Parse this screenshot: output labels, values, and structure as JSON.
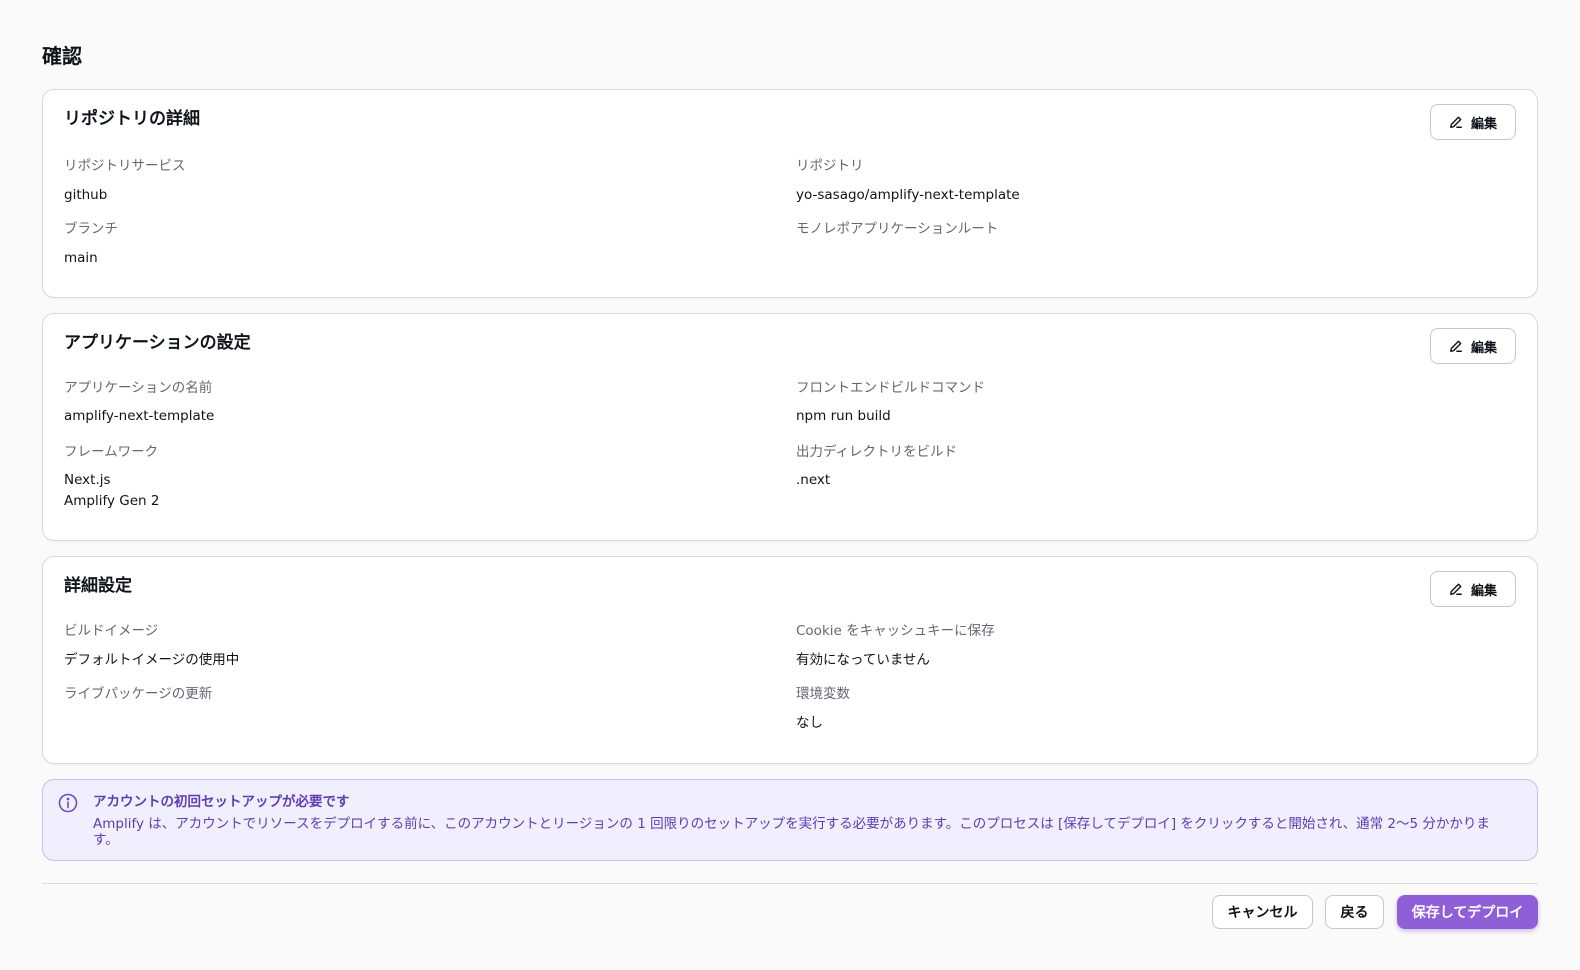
{
  "page": {
    "title": "確認"
  },
  "edit_label": "編集",
  "repo": {
    "title": "リポジトリの詳細",
    "service_label": "リポジトリサービス",
    "service_value": "github",
    "repo_label": "リポジトリ",
    "repo_value": "yo-sasago/amplify-next-template",
    "branch_label": "ブランチ",
    "branch_value": "main",
    "monorepo_label": "モノレポアプリケーションルート"
  },
  "app": {
    "title": "アプリケーションの設定",
    "name_label": "アプリケーションの名前",
    "name_value": "amplify-next-template",
    "build_cmd_label": "フロントエンドビルドコマンド",
    "build_cmd_value": "npm run build",
    "framework_label": "フレームワーク",
    "framework_value_1": "Next.js",
    "framework_value_2": "Amplify Gen 2",
    "output_dir_label": "出力ディレクトリをビルド",
    "output_dir_value": ".next"
  },
  "advanced": {
    "title": "詳細設定",
    "build_image_label": "ビルドイメージ",
    "build_image_value": "デフォルトイメージの使用中",
    "cookie_label": "Cookie をキャッシュキーに保存",
    "cookie_value": "有効になっていません",
    "live_pkg_label": "ライブパッケージの更新",
    "env_label": "環境変数",
    "env_value": "なし"
  },
  "alert": {
    "title": "アカウントの初回セットアップが必要です",
    "body": "Amplify は、アカウントでリソースをデプロイする前に、このアカウントとリージョンの 1 回限りのセットアップを実行する必要があります。このプロセスは [保存してデプロイ] をクリックすると開始され、通常 2〜5 分かかります。"
  },
  "footer": {
    "cancel_label": "キャンセル",
    "back_label": "戻る",
    "deploy_label": "保存してデプロイ"
  },
  "colors": {
    "accent": "#8f5fd8",
    "info_bg": "#f1eefd",
    "info_text": "#5b3fb3"
  }
}
